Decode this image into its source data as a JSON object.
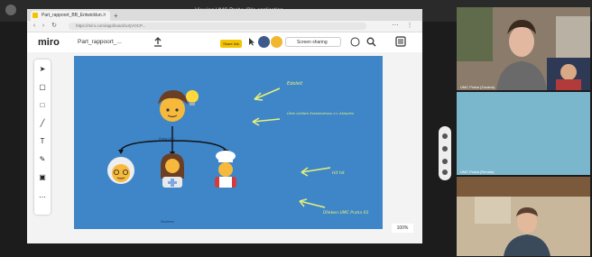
{
  "meeting": {
    "title": "Viewing UMC Praha (3)'s application"
  },
  "browser": {
    "tab_title": "Part_rappoort_BB_Entwicklun...",
    "address": "https://miro.com/app/board/uXjVOCP..."
  },
  "miro": {
    "logo": "miro",
    "board_name": "Part_rappoort_...",
    "share_label": "Share link",
    "present_label": "Screen sharing",
    "zoom": "100%"
  },
  "canvas": {
    "bg_color": "#3f86c9",
    "arrow_color": "#e6f078",
    "note_top": "Edeleit",
    "note_middle": "Ülein vielfach Kratzendhuss >> Ablaufen",
    "note_bottom1": "Hit hit",
    "note_bottom2": "Ülleben UMC Praha 03",
    "center_caption": "Praha UMC",
    "bottom_caption": "Studieren"
  },
  "participants": [
    {
      "label": "UMC Praha (Zuzana)"
    },
    {
      "label": "UMC Praha (Renata)"
    },
    {
      "label": ""
    }
  ]
}
